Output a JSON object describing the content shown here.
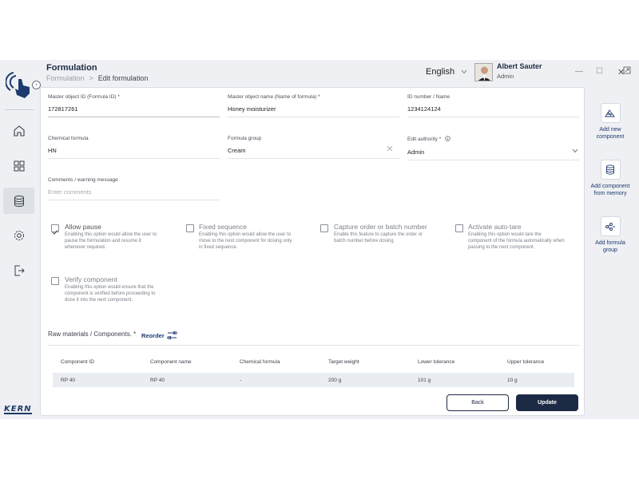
{
  "header": {
    "title": "Formulation",
    "breadcrumb_root": "Formulation",
    "breadcrumb_sep": ">",
    "breadcrumb_current": "Edit formulation",
    "language": "English",
    "user_name": "Albert Sauter",
    "user_role": "Admin"
  },
  "brand": {
    "logo_text": "KERN"
  },
  "nav": {
    "items": [
      {
        "icon": "home-icon"
      },
      {
        "icon": "dashboard-icon"
      },
      {
        "icon": "database-icon",
        "active": true
      },
      {
        "icon": "settings-icon"
      },
      {
        "icon": "logout-icon"
      }
    ]
  },
  "form": {
    "master_id_label": "Master object ID (Formula ID) *",
    "master_id_value": "172817261",
    "master_name_label": "Master object name (Name of formula) *",
    "master_name_value": "Honey moisturizer",
    "id_number_label": "ID number / Name",
    "id_number_value": "1234124124",
    "chem_label": "Chemical formula",
    "chem_value": "HN",
    "group_label": "Formula group",
    "group_value": "Cream",
    "authority_label": "Edit authority *",
    "authority_value": "Admin",
    "comments_label": "Comments / warning message",
    "comments_placeholder": "Enter comments"
  },
  "options": [
    {
      "title": "Allow pause",
      "checked": true,
      "desc1": "Enabling this option would allow the user to",
      "desc2": "pause the formulation and resume it",
      "desc3": "whenever required."
    },
    {
      "title": "Fixed sequence",
      "checked": false,
      "desc1": "Enabling this option would allow the user to",
      "desc2": "move to the next component for dosing only",
      "desc3": "in fixed sequence."
    },
    {
      "title": "Capture order or batch number",
      "checked": false,
      "desc1": "Enable this feature to capture the order or",
      "desc2": "batch number before dosing",
      "desc3": ""
    },
    {
      "title": "Activate auto-tare",
      "checked": false,
      "desc1": "Enabling this option would tare the",
      "desc2": "component of the formula automatically when",
      "desc3": "passing to the next component."
    },
    {
      "title": "Verify component",
      "checked": false,
      "desc1": "Enabling this option would ensure that the",
      "desc2": "component is verified before proceeding to",
      "desc3": "dose it into the next component."
    }
  ],
  "components": {
    "label": "Raw materials / Components. *",
    "reorder": "Reorder",
    "headers": [
      "Component ID",
      "Component name",
      "Chemical formula",
      "Target weight",
      "Lower tolerance",
      "Upper tolerance"
    ],
    "rows": [
      [
        "RP 40",
        "RP 40",
        "-",
        "200 g",
        "101 g",
        "10 g"
      ]
    ]
  },
  "actions": {
    "back": "Back",
    "update": "Update"
  },
  "rail": {
    "add_component": "Add new component",
    "add_from_memory": "Add component from memory",
    "add_group": "Add formula group"
  },
  "colors": {
    "primary": "#1d2a44",
    "accent": "#1d3a6e",
    "background": "#eef0f3"
  }
}
